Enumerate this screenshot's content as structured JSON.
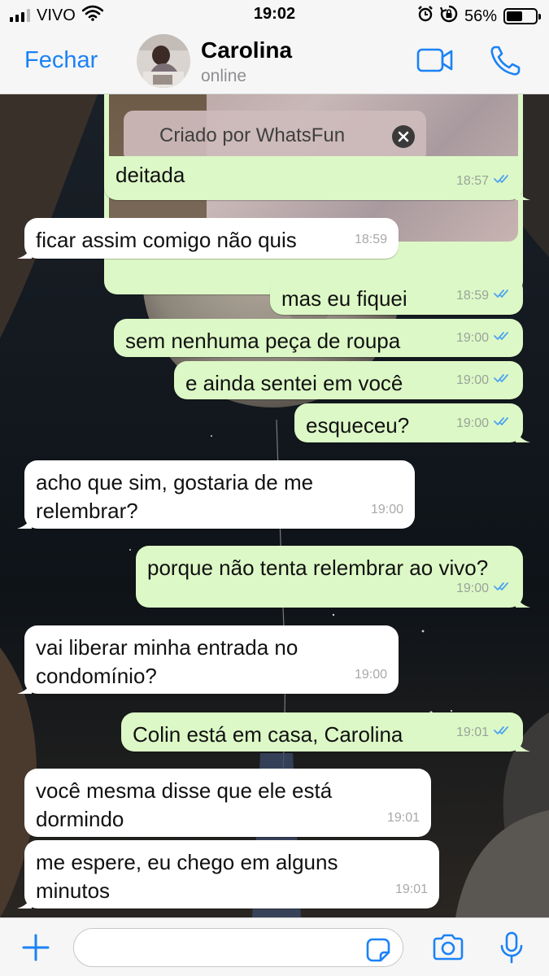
{
  "status_bar": {
    "carrier": "VIVO",
    "time": "19:02",
    "battery": "56%",
    "battery_level": 0.56,
    "icons": [
      "signal-icon",
      "wifi-icon",
      "alarm-icon",
      "rotation-lock-icon",
      "battery-icon"
    ]
  },
  "header": {
    "back_label": "Fechar",
    "contact_name": "Carolina",
    "contact_status": "online",
    "actions": [
      "video-call-icon",
      "phone-icon"
    ]
  },
  "media": {
    "watermark": "Criado por WhatsFun"
  },
  "messages": [
    {
      "dir": "out",
      "lines": [
        "deitada"
      ],
      "time": "18:57",
      "read": true
    },
    {
      "dir": "in",
      "lines": [
        "ficar assim comigo não quis"
      ],
      "time": "18:59"
    },
    {
      "dir": "out",
      "lines": [
        "mas eu fiquei"
      ],
      "time": "18:59",
      "read": true
    },
    {
      "dir": "out",
      "lines": [
        "sem nenhuma peça de roupa"
      ],
      "time": "19:00",
      "read": true
    },
    {
      "dir": "out",
      "lines": [
        "e ainda sentei em você"
      ],
      "time": "19:00",
      "read": true
    },
    {
      "dir": "out",
      "lines": [
        "esqueceu?"
      ],
      "time": "19:00",
      "read": true
    },
    {
      "dir": "in",
      "lines": [
        "acho que sim, gostaria de me",
        "relembrar?"
      ],
      "time": "19:00"
    },
    {
      "dir": "out",
      "lines": [
        "porque não tenta relembrar ao vivo?"
      ],
      "time": "19:00",
      "read": true
    },
    {
      "dir": "in",
      "lines": [
        "vai liberar minha entrada no",
        "condomínio?"
      ],
      "time": "19:00"
    },
    {
      "dir": "out",
      "lines": [
        "Colin está em casa, Carolina"
      ],
      "time": "19:01",
      "read": true
    },
    {
      "dir": "in",
      "lines": [
        "você mesma disse que ele está",
        "dormindo"
      ],
      "time": "19:01"
    },
    {
      "dir": "in",
      "lines": [
        "me espere, eu chego em alguns",
        "minutos"
      ],
      "time": "19:01"
    }
  ],
  "input": {
    "placeholder": "",
    "icons": [
      "plus-icon",
      "sticker-icon",
      "camera-icon",
      "microphone-icon"
    ]
  },
  "colors": {
    "accent": "#1b82f5",
    "outgoing_bubble": "#dcf8c6",
    "incoming_bubble": "#ffffff",
    "read_ticks": "#4fa3f0"
  }
}
